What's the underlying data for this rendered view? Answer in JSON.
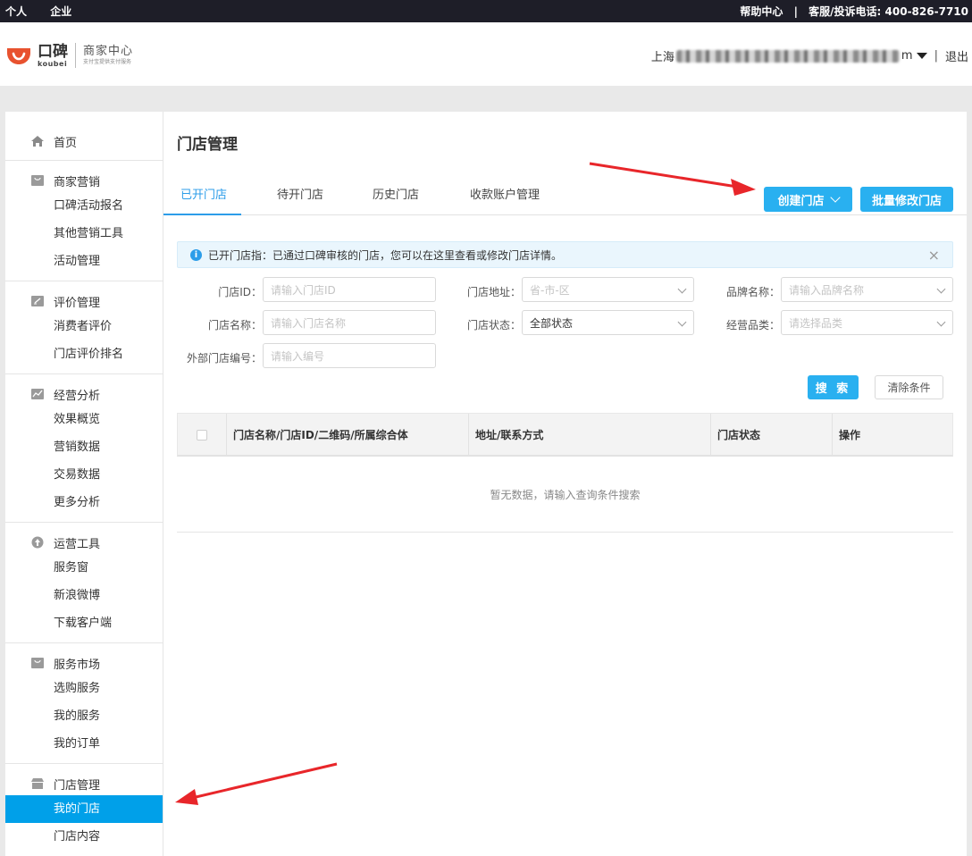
{
  "topbar": {
    "personal": "个人",
    "enterprise": "企业",
    "help": "帮助中心",
    "separator": "|",
    "hotline": "客服/投诉电话: 400-826-7710"
  },
  "header": {
    "logo_cn": "口碑",
    "logo_en": "koubei",
    "center_title": "商家中心",
    "center_sub": "支付宝提供支付服务",
    "user_prefix": "上海",
    "user_suffix": "m",
    "logout": "退出"
  },
  "sidebar": {
    "home": "首页",
    "groups": [
      {
        "title": "商家营销",
        "icon": "bag-icon",
        "items": [
          "口碑活动报名",
          "其他营销工具",
          "活动管理"
        ]
      },
      {
        "title": "评价管理",
        "icon": "edit-icon",
        "items": [
          "消费者评价",
          "门店评价排名"
        ]
      },
      {
        "title": "经营分析",
        "icon": "chart-icon",
        "items": [
          "效果概览",
          "营销数据",
          "交易数据",
          "更多分析"
        ]
      },
      {
        "title": "运营工具",
        "icon": "tool-icon",
        "items": [
          "服务窗",
          "新浪微博",
          "下载客户端"
        ]
      },
      {
        "title": "服务市场",
        "icon": "bag-icon",
        "items": [
          "选购服务",
          "我的服务",
          "我的订单"
        ]
      },
      {
        "title": "门店管理",
        "icon": "store-icon",
        "items": [
          "我的门店",
          "门店内容"
        ]
      }
    ]
  },
  "main": {
    "title": "门店管理",
    "tabs": [
      "已开门店",
      "待开门店",
      "历史门店",
      "收款账户管理"
    ],
    "create_btn": "创建门店",
    "batch_btn": "批量修改门店",
    "notice": "已开门店指：已通过口碑审核的门店，您可以在这里查看或修改门店详情。",
    "filters": {
      "store_id_label": "门店ID：",
      "store_id_placeholder": "请输入门店ID",
      "address_label": "门店地址：",
      "address_placeholder": "省-市-区",
      "brand_label": "品牌名称：",
      "brand_placeholder": "请输入品牌名称",
      "store_name_label": "门店名称：",
      "store_name_placeholder": "请输入门店名称",
      "status_label": "门店状态：",
      "status_value": "全部状态",
      "category_label": "经营品类：",
      "category_placeholder": "请选择品类",
      "ext_id_label": "外部门店编号：",
      "ext_id_placeholder": "请输入编号"
    },
    "search_btn": "搜 索",
    "clear_btn": "清除条件",
    "table": {
      "columns": [
        "门店名称/门店ID/二维码/所属综合体",
        "地址/联系方式",
        "门店状态",
        "操作"
      ],
      "empty": "暂无数据，请输入查询条件搜索"
    }
  },
  "colors": {
    "accent": "#29b0f0",
    "active_sidebar": "#00a0e9",
    "arrow": "#e8262a"
  }
}
